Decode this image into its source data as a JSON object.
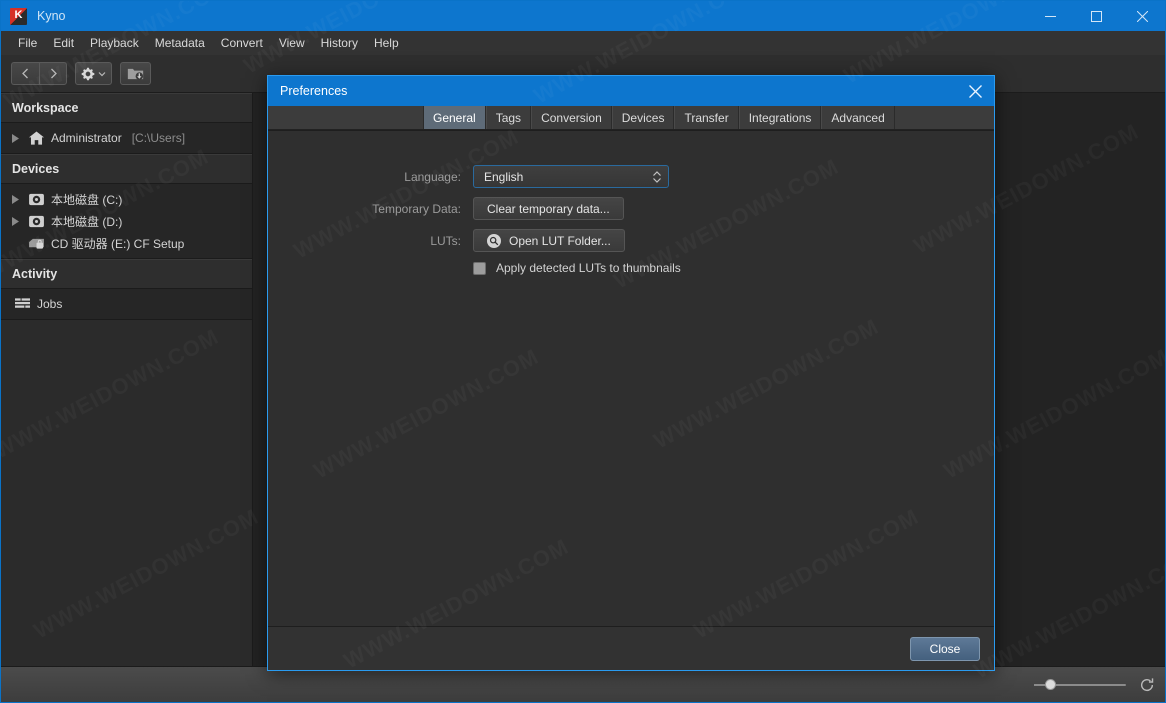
{
  "window": {
    "app_name": "Kyno",
    "logo_letter": "K",
    "accent_color": "#0d76ce",
    "controls": {
      "minimize": "minimize-icon",
      "maximize": "maximize-icon",
      "close": "close-icon"
    }
  },
  "menubar": {
    "items": [
      "File",
      "Edit",
      "Playback",
      "Metadata",
      "Convert",
      "View",
      "History",
      "Help"
    ]
  },
  "toolbar": {
    "back_icon": "chevron-left-icon",
    "forward_icon": "chevron-right-icon",
    "settings_icon": "gear-icon",
    "settings_chevron": "chevron-down-icon",
    "import_icon": "folder-download-icon"
  },
  "sidebar": {
    "sections": [
      {
        "title": "Workspace",
        "rows": [
          {
            "twisty": true,
            "icon": "home-icon",
            "label": "Administrator",
            "dim": "[C:\\Users]"
          }
        ]
      },
      {
        "title": "Devices",
        "rows": [
          {
            "twisty": true,
            "icon": "harddisk-icon",
            "label": "本地磁盘 (C:)",
            "dim": ""
          },
          {
            "twisty": true,
            "icon": "harddisk-icon",
            "label": "本地磁盘 (D:)",
            "dim": ""
          },
          {
            "twisty": false,
            "icon": "cdrom-lock-icon",
            "label": "CD 驱动器 (E:) CF Setup",
            "dim": ""
          }
        ]
      },
      {
        "title": "Activity",
        "rows": [
          {
            "twisty": false,
            "icon": "jobs-list-icon",
            "label": "Jobs",
            "dim": ""
          }
        ]
      }
    ]
  },
  "dialog": {
    "title": "Preferences",
    "close_icon": "close-icon",
    "tabs": [
      {
        "label": "General",
        "active": true
      },
      {
        "label": "Tags",
        "active": false
      },
      {
        "label": "Conversion",
        "active": false
      },
      {
        "label": "Devices",
        "active": false
      },
      {
        "label": "Transfer",
        "active": false
      },
      {
        "label": "Integrations",
        "active": false
      },
      {
        "label": "Advanced",
        "active": false
      }
    ],
    "general": {
      "language_label": "Language:",
      "language_value": "English",
      "language_options": [
        "English"
      ],
      "language_chevron": "chevron-updown-icon",
      "temp_label": "Temporary Data:",
      "temp_button": "Clear temporary data...",
      "luts_label": "LUTs:",
      "luts_button": "Open LUT Folder...",
      "luts_button_icon": "magnifier-icon",
      "checkbox_label": "Apply detected LUTs to thumbnails",
      "checkbox_checked": false
    },
    "footer": {
      "close_label": "Close"
    }
  },
  "statusbar": {
    "zoom_slider_value": 12,
    "zoom_slider_min": 0,
    "zoom_slider_max": 100,
    "refresh_icon": "refresh-icon"
  },
  "watermark": {
    "text": "WWW.WEIDOWN.COM"
  }
}
